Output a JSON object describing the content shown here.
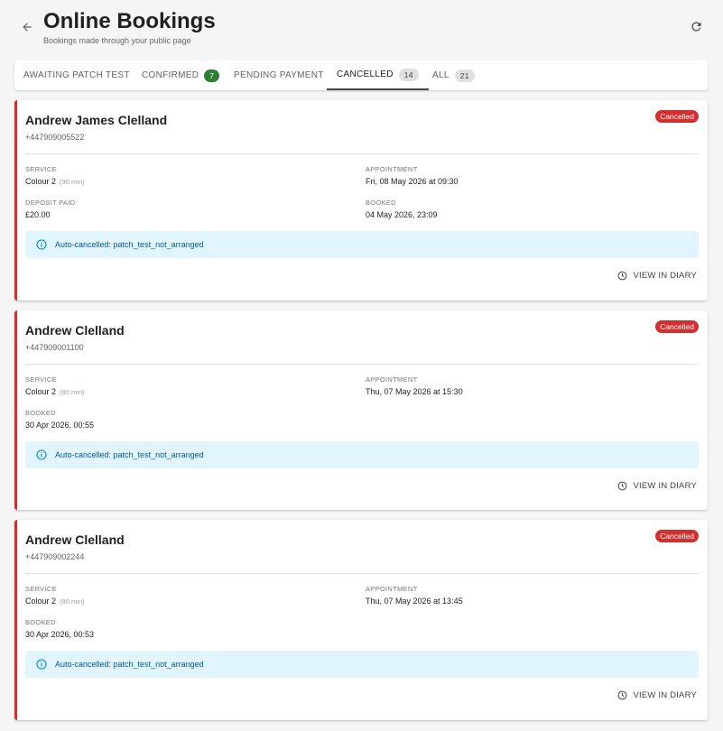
{
  "header": {
    "title": "Online Bookings",
    "subtitle": "Bookings made through your public page",
    "back_icon": "arrow-left-icon",
    "refresh_icon": "refresh-icon"
  },
  "tabs": [
    {
      "label": "AWAITING PATCH TEST",
      "badge": null
    },
    {
      "label": "CONFIRMED",
      "badge": "7"
    },
    {
      "label": "PENDING PAYMENT",
      "badge": null
    },
    {
      "label": "CANCELLED",
      "badge": "14"
    },
    {
      "label": "ALL",
      "badge": "21"
    }
  ],
  "active_tab": "CANCELLED",
  "bookings": [
    {
      "name": "Andrew James Clelland",
      "phone": "+447909005522",
      "status": "Cancelled",
      "service_label": "SERVICE",
      "service": "Colour 2",
      "duration": "(90 min)",
      "appointment_label": "APPOINTMENT",
      "appointment": "Fri, 08 May 2026 at 09:30",
      "deposit_label": "DEPOSIT PAID",
      "deposit": "£20.00",
      "booked_label": "BOOKED",
      "booked": "04 May 2026, 23:09",
      "alert": "Auto-cancelled: patch_test_not_arranged",
      "action": "VIEW IN DIARY"
    },
    {
      "name": "Andrew Clelland",
      "phone": "+447909001100",
      "status": "Cancelled",
      "service_label": "SERVICE",
      "service": "Colour 2",
      "duration": "(90 min)",
      "appointment_label": "APPOINTMENT",
      "appointment": "Thu, 07 May 2026 at 15:30",
      "booked_label": "BOOKED",
      "booked": "30 Apr 2026, 00:55",
      "alert": "Auto-cancelled: patch_test_not_arranged",
      "action": "VIEW IN DIARY"
    },
    {
      "name": "Andrew Clelland",
      "phone": "+447909002244",
      "status": "Cancelled",
      "service_label": "SERVICE",
      "service": "Colour 2",
      "duration": "(90 min)",
      "appointment_label": "APPOINTMENT",
      "appointment": "Thu, 07 May 2026 at 13:45",
      "booked_label": "BOOKED",
      "booked": "30 Apr 2026, 00:53",
      "alert": "Auto-cancelled: patch_test_not_arranged",
      "action": "VIEW IN DIARY"
    }
  ],
  "colors": {
    "cancelled": "#d32f2f",
    "confirmed_badge": "#2e7d32",
    "alert_bg": "#e1f5fe",
    "alert_text": "#01579b"
  }
}
